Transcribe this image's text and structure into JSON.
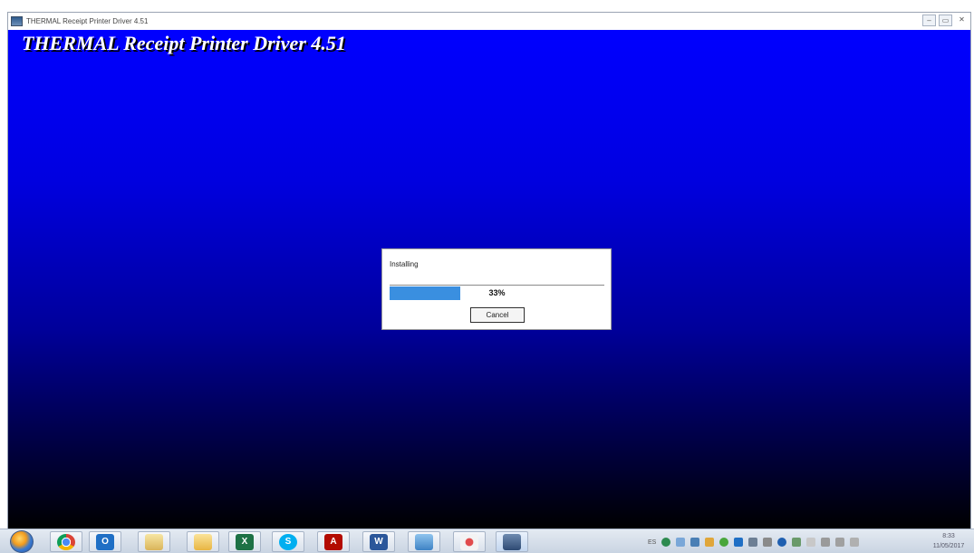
{
  "window": {
    "title": "THERMAL Receipt Printer Driver 4.51",
    "controls": {
      "minimize": "–",
      "maximize": "▭",
      "close": "✕"
    }
  },
  "app": {
    "heading": "THERMAL Receipt Printer Driver 4.51"
  },
  "dialog": {
    "label": "Installing",
    "progress_percent": 33,
    "progress_text": "33%",
    "cancel_label": "Cancel"
  },
  "taskbar": {
    "items": [
      {
        "icon": "chrome-icon",
        "label": ""
      },
      {
        "icon": "outlook-icon",
        "label": "O"
      },
      {
        "icon": "file-explorer-icon",
        "label": ""
      },
      {
        "icon": "folder-icon",
        "label": ""
      },
      {
        "icon": "excel-icon",
        "label": "X"
      },
      {
        "icon": "skype-icon",
        "label": "S"
      },
      {
        "icon": "acrobat-icon",
        "label": "A"
      },
      {
        "icon": "word-icon",
        "label": "W"
      },
      {
        "icon": "remote-desktop-icon",
        "label": ""
      },
      {
        "icon": "snipping-tool-icon",
        "label": ""
      },
      {
        "icon": "installer-icon",
        "label": ""
      }
    ],
    "tray_language": "ES",
    "clock_time": "8:33",
    "clock_date": "11/05/2017"
  },
  "colors": {
    "gradient_top": "#0000ff",
    "gradient_bottom": "#000000",
    "progress_fill": "#3a8fe0"
  }
}
